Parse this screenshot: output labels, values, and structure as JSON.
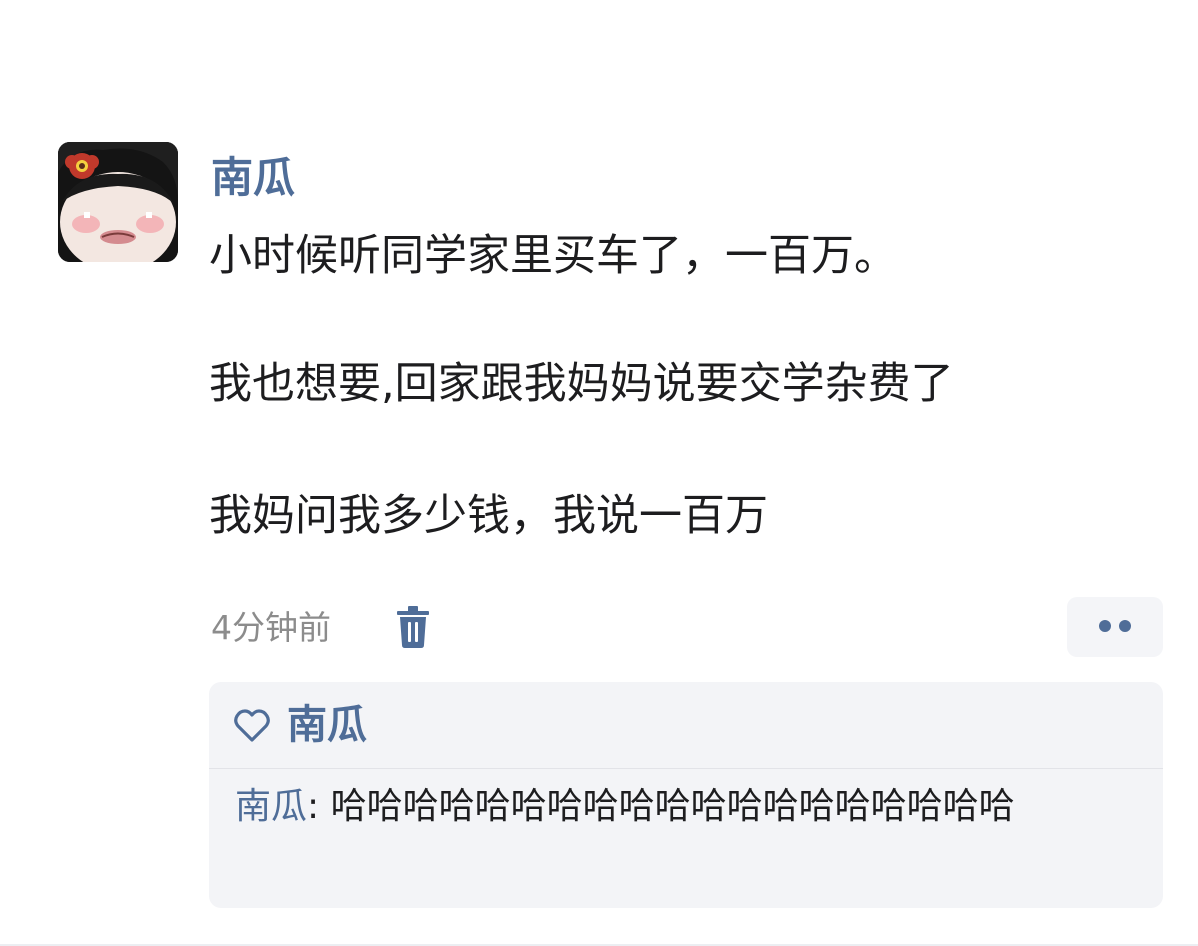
{
  "post": {
    "author": "南瓜",
    "lines": [
      "小时候听同学家里买车了，一百万。",
      "我也想要,回家跟我妈妈说要交学杂费了",
      "我妈问我多少钱，我说一百万"
    ],
    "timestamp": "4分钟前",
    "icons": {
      "delete": "trash-icon",
      "more": "more-dots-icon",
      "like": "heart-icon"
    }
  },
  "likes": {
    "names": "南瓜"
  },
  "comments": [
    {
      "author": "南瓜",
      "separator": ": ",
      "text": "哈哈哈哈哈哈哈哈哈哈哈哈哈哈哈哈哈哈哈"
    }
  ],
  "colors": {
    "link": "#4f6d98",
    "text": "#1d1d1f",
    "muted": "#8c8c8c",
    "panel": "#f3f4f7"
  }
}
